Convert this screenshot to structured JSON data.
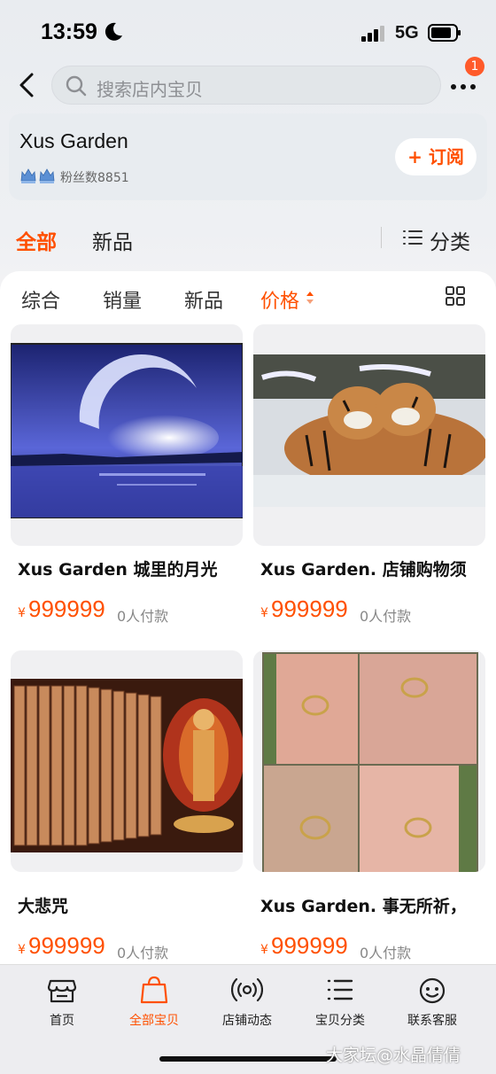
{
  "status": {
    "time": "13:59",
    "network": "5G"
  },
  "nav": {
    "search_placeholder": "搜索店内宝贝",
    "badge": "1"
  },
  "shop": {
    "name": "Xus Garden",
    "fans": "粉丝数8851",
    "subscribe_label": "+ 订阅"
  },
  "main_tabs": [
    "全部",
    "新品"
  ],
  "category_label": "分类",
  "sort_tabs": [
    "综合",
    "销量",
    "新品",
    "价格"
  ],
  "products": [
    {
      "title": "Xus Garden   城里的月光",
      "currency": "¥",
      "price": "999999",
      "sold": "0人付款"
    },
    {
      "title": "Xus Garden. 店铺购物须",
      "currency": "¥",
      "price": "999999",
      "sold": "0人付款"
    },
    {
      "title": "大悲咒",
      "currency": "¥",
      "price": "999999",
      "sold": "0人付款"
    },
    {
      "title": "Xus Garden.  事无所祈，",
      "currency": "¥",
      "price": "999999",
      "sold": "0人付款"
    }
  ],
  "bottom_nav": [
    "首页",
    "全部宝贝",
    "店铺动态",
    "宝贝分类",
    "联系客服"
  ],
  "watermark": "大家坛@水晶倩倩",
  "colors": {
    "accent": "#ff5000"
  },
  "icons": [
    "moon-icon",
    "signal-icon",
    "battery-icon",
    "back-icon",
    "search-icon",
    "more-icon",
    "crown-icon",
    "list-icon",
    "grid-icon",
    "store-icon",
    "bag-icon",
    "broadcast-icon",
    "menu-list-icon",
    "smile-icon"
  ]
}
